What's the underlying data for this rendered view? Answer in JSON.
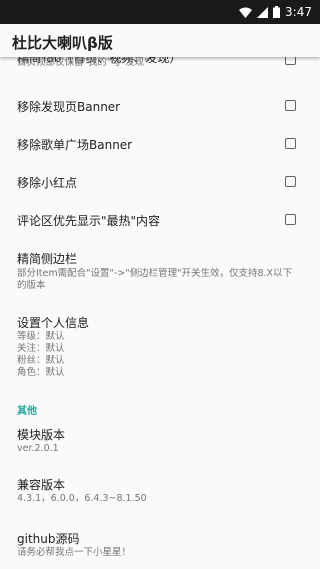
{
  "status": {
    "time": "3:47"
  },
  "appbar": {
    "title": "杜比大喇叭β版"
  },
  "items": [
    {
      "title": "精简Tab（首页、视频、发现）",
      "subtitle": "首页顶部仅保留\"我的\"与\"发现\"",
      "checked": false
    },
    {
      "title": "移除发现页Banner",
      "checked": false
    },
    {
      "title": "移除歌单广场Banner",
      "checked": false
    },
    {
      "title": "移除小红点",
      "checked": false
    },
    {
      "title": "评论区优先显示\"最热\"内容",
      "checked": false
    }
  ],
  "sidebar": {
    "title": "精简侧边栏",
    "subtitle": "部分Item需配合\"设置\"->\"侧边栏管理\"开关生效，仅支持8.X以下的版本"
  },
  "personal": {
    "title": "设置个人信息",
    "level": "等级：默认",
    "follow": "关注：默认",
    "fans": "粉丝：默认",
    "role": "角色：默认"
  },
  "other_category": "其他",
  "module_version": {
    "title": "模块版本",
    "value": "ver.2.0.1"
  },
  "compat_version": {
    "title": "兼容版本",
    "value": "4.3.1，6.0.0，6.4.3~8.1.50"
  },
  "github": {
    "title": "github源码",
    "subtitle": "请务必帮我点一下小星星！"
  }
}
